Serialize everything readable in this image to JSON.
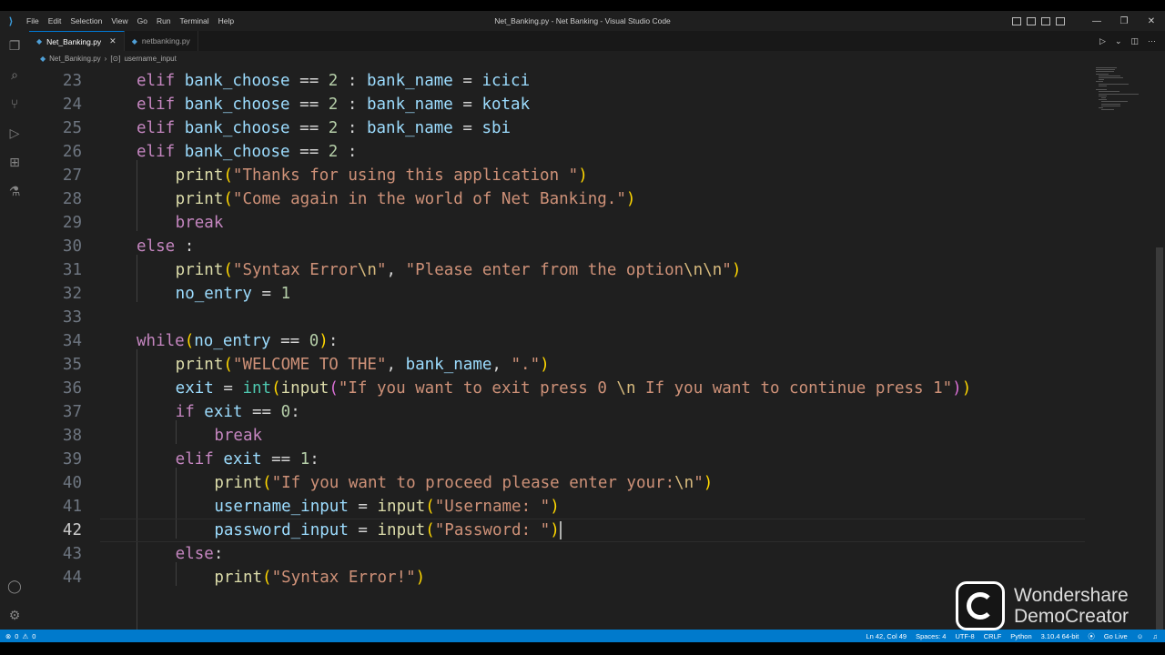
{
  "window": {
    "title": "Net_Banking.py - Net Banking - Visual Studio Code",
    "menu": [
      "File",
      "Edit",
      "Selection",
      "View",
      "Go",
      "Run",
      "Terminal",
      "Help"
    ]
  },
  "tabs": [
    {
      "label": "Net_Banking.py",
      "active": true
    },
    {
      "label": "netbanking.py",
      "active": false
    }
  ],
  "breadcrumb": {
    "file": "Net_Banking.py",
    "symbol": "username_input"
  },
  "editor": {
    "current_line": 42,
    "lines": [
      {
        "n": "23",
        "code": "elif bank_choose == 2 : bank_name = icici"
      },
      {
        "n": "24",
        "code": "elif bank_choose == 2 : bank_name = kotak"
      },
      {
        "n": "25",
        "code": "elif bank_choose == 2 : bank_name = sbi"
      },
      {
        "n": "26",
        "code": "elif bank_choose == 2 :"
      },
      {
        "n": "27",
        "code": "print(\"Thanks for using this application \")"
      },
      {
        "n": "28",
        "code": "print(\"Come again in the world of Net Banking.\")"
      },
      {
        "n": "29",
        "code": "break"
      },
      {
        "n": "30",
        "code": "else :"
      },
      {
        "n": "31",
        "code": "print(\"Syntax Error\\n\", \"Please enter from the option\\n\\n\")"
      },
      {
        "n": "32",
        "code": "no_entry = 1"
      },
      {
        "n": "33",
        "code": ""
      },
      {
        "n": "34",
        "code": "while(no_entry == 0):"
      },
      {
        "n": "35",
        "code": "print(\"WELCOME TO THE\", bank_name, \".\")"
      },
      {
        "n": "36",
        "code": "exit = int(input(\"If you want to exit press 0 \\n If you want to continue press 1\"))"
      },
      {
        "n": "37",
        "code": "if exit == 0:"
      },
      {
        "n": "38",
        "code": "break"
      },
      {
        "n": "39",
        "code": "elif exit == 1:"
      },
      {
        "n": "40",
        "code": "print(\"If you want to proceed please enter your:\\n\")"
      },
      {
        "n": "41",
        "code": "username_input = input(\"Username: \")"
      },
      {
        "n": "42",
        "code": "password_input = input(\"Password: \")"
      },
      {
        "n": "43",
        "code": "else:"
      },
      {
        "n": "44",
        "code": "print(\"Syntax Error!\")"
      }
    ]
  },
  "statusbar": {
    "problems": "0",
    "warnings": "0",
    "position": "Ln 42, Col 49",
    "spaces": "Spaces: 4",
    "encoding": "UTF-8",
    "eol": "CRLF",
    "language": "Python",
    "interpreter": "3.10.4 64-bit",
    "golive": "Go Live"
  },
  "watermark": {
    "line1": "Wondershare",
    "line2": "DemoCreator"
  }
}
